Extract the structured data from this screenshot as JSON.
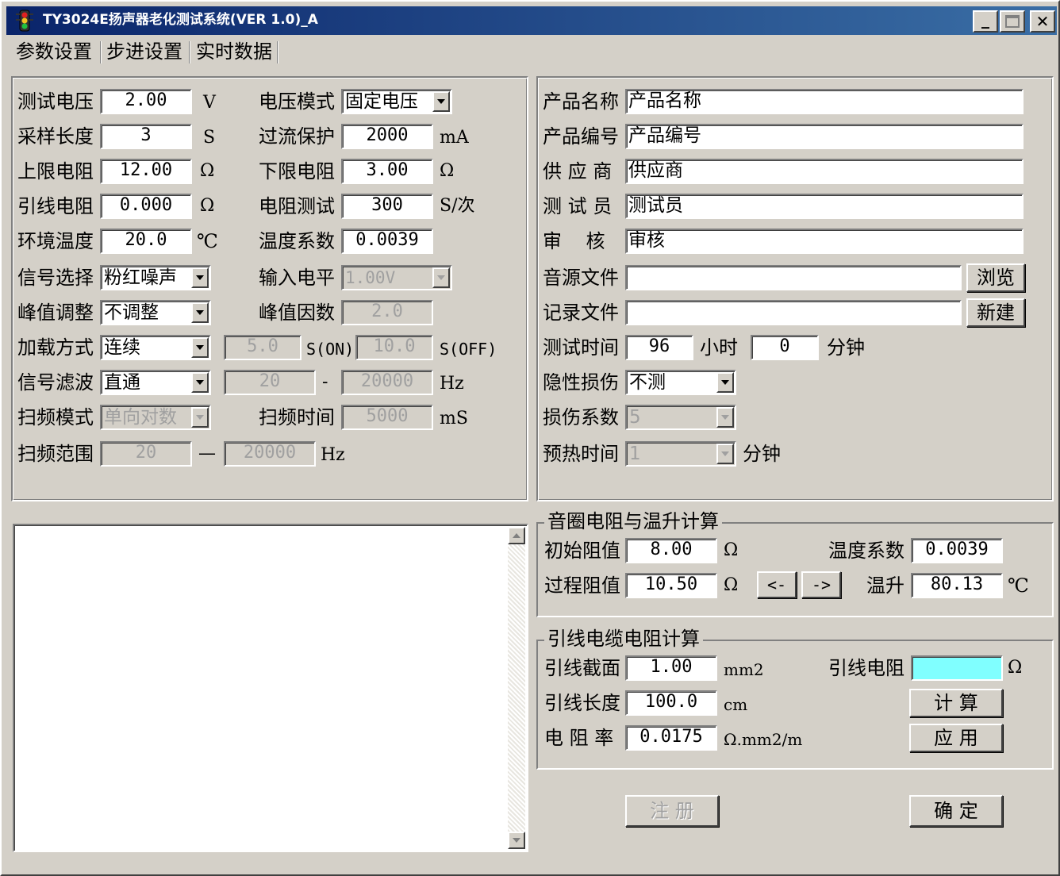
{
  "window": {
    "title": "TY3024E扬声器老化测试系统(VER 1.0)_A",
    "min_symbol": "_",
    "close_symbol": "✕"
  },
  "tabs": [
    "参数设置",
    "步进设置",
    "实时数据"
  ],
  "left": {
    "test_voltage": {
      "label": "测试电压",
      "value": "2.00",
      "unit": "V"
    },
    "voltage_mode": {
      "label": "电压模式",
      "value": "固定电压"
    },
    "sample_length": {
      "label": "采样长度",
      "value": "3",
      "unit": "S"
    },
    "overcurrent": {
      "label": "过流保护",
      "value": "2000",
      "unit": "mA"
    },
    "upper_res": {
      "label": "上限电阻",
      "value": "12.00",
      "unit": "Ω"
    },
    "lower_res": {
      "label": "下限电阻",
      "value": "3.00",
      "unit": "Ω"
    },
    "lead_res": {
      "label": "引线电阻",
      "value": "0.000",
      "unit": "Ω"
    },
    "res_test": {
      "label": "电阻测试",
      "value": "300",
      "unit": "S/次"
    },
    "env_temp": {
      "label": "环境温度",
      "value": "20.0",
      "unit": "℃"
    },
    "temp_coef": {
      "label": "温度系数",
      "value": "0.0039"
    },
    "signal_select": {
      "label": "信号选择",
      "value": "粉红噪声"
    },
    "input_level": {
      "label": "输入电平",
      "value": "1.00V"
    },
    "peak_adjust": {
      "label": "峰值调整",
      "value": "不调整"
    },
    "peak_factor": {
      "label": "峰值因数",
      "value": "2.0"
    },
    "load_mode": {
      "label": "加载方式",
      "value": "连续",
      "on_value": "5.0",
      "on_unit": "S(ON)",
      "off_value": "10.0",
      "off_unit": "S(OFF)"
    },
    "signal_filter": {
      "label": "信号滤波",
      "value": "直通",
      "from": "20",
      "dash": "-",
      "to": "20000",
      "unit": "Hz"
    },
    "sweep_mode": {
      "label": "扫频模式",
      "value": "单向对数"
    },
    "sweep_time": {
      "label": "扫频时间",
      "value": "5000",
      "unit": "mS"
    },
    "sweep_range": {
      "label": "扫频范围",
      "from": "20",
      "dash": "—",
      "to": "20000",
      "unit": "Hz"
    }
  },
  "right": {
    "product_name": {
      "label": "产品名称",
      "value": "产品名称"
    },
    "product_no": {
      "label": "产品编号",
      "value": "产品编号"
    },
    "supplier": {
      "label": "供 应 商",
      "value": "供应商"
    },
    "tester": {
      "label": "测 试 员",
      "value": "测试员"
    },
    "auditor": {
      "label": "审    核",
      "value": "审核"
    },
    "source_file": {
      "label": "音源文件",
      "value": "",
      "button": "浏览"
    },
    "record_file": {
      "label": "记录文件",
      "value": "",
      "button": "新建"
    },
    "test_time": {
      "label": "测试时间",
      "hours": "96",
      "hours_unit": "小时",
      "minutes": "0",
      "minutes_unit": "分钟"
    },
    "hidden_damage": {
      "label": "隐性损伤",
      "value": "不测"
    },
    "damage_coef": {
      "label": "损伤系数",
      "value": "5"
    },
    "preheat": {
      "label": "预热时间",
      "value": "1",
      "unit": "分钟"
    }
  },
  "coil": {
    "title": "音圈电阻与温升计算",
    "initial": {
      "label": "初始阻值",
      "value": "8.00",
      "unit": "Ω"
    },
    "temp_coef": {
      "label": "温度系数",
      "value": "0.0039"
    },
    "process": {
      "label": "过程阻值",
      "value": "10.50",
      "unit": "Ω"
    },
    "left_btn": "<-",
    "right_btn": "->",
    "temp_rise": {
      "label": "温升",
      "value": "80.13",
      "unit": "℃"
    }
  },
  "cable": {
    "title": "引线电缆电阻计算",
    "cross": {
      "label": "引线截面",
      "value": "1.00",
      "unit": "mm2"
    },
    "lead_res": {
      "label": "引线电阻",
      "value": "",
      "unit": "Ω"
    },
    "length": {
      "label": "引线长度",
      "value": "100.0",
      "unit": "cm"
    },
    "resistivity": {
      "label": "电 阻 率",
      "value": "0.0175",
      "unit": "Ω.mm2/m"
    },
    "calc_btn": "计 算",
    "apply_btn": "应 用"
  },
  "footer": {
    "register_btn": "注 册",
    "ok_btn": "确 定"
  }
}
